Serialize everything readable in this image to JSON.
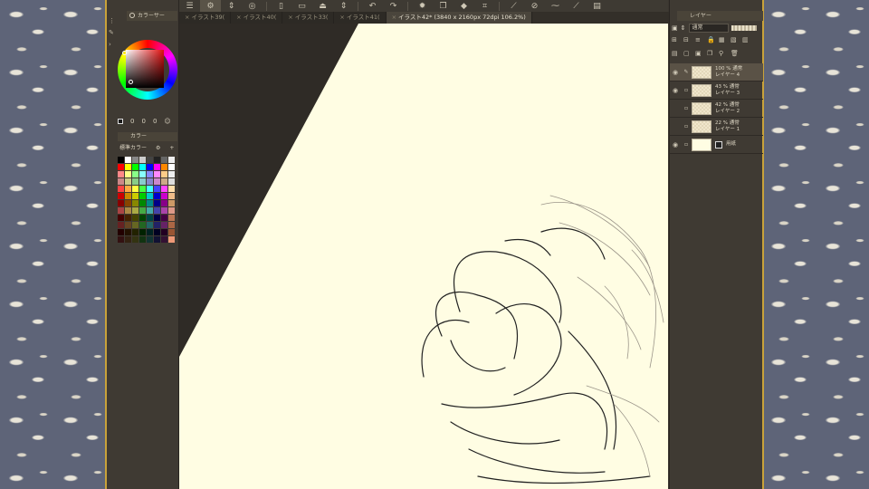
{
  "left_panel": {
    "color_wheel_title": "カラーサー",
    "color_values": [
      "0",
      "0",
      "0"
    ],
    "sub_panel_title": "カラー",
    "palette_dropdown": "標準カラー"
  },
  "tabs": [
    {
      "label": "イラスト39(",
      "active": false
    },
    {
      "label": "イラスト40(",
      "active": false
    },
    {
      "label": "イラスト33(",
      "active": false
    },
    {
      "label": "イラスト41(",
      "active": false
    },
    {
      "label": "イラスト42* (3840 x 2160px 72dpi 106.2%)",
      "active": true
    }
  ],
  "right_panel": {
    "title": "レイヤー",
    "blend_mode": "通常",
    "layers": [
      {
        "opacity": "100 %  通常",
        "name": "レイヤー 4",
        "selected": true,
        "visible": true
      },
      {
        "opacity": "43 %  通常",
        "name": "レイヤー 3",
        "selected": false,
        "visible": true
      },
      {
        "opacity": "42 %  通常",
        "name": "レイヤー 2",
        "selected": false,
        "visible": false
      },
      {
        "opacity": "22 %  通常",
        "name": "レイヤー 1",
        "selected": false,
        "visible": false
      },
      {
        "opacity": "",
        "name": "用紙",
        "selected": false,
        "visible": true,
        "paper": true
      }
    ]
  },
  "colors": {
    "canvas": "#fffde3",
    "app_bg": "#3b3630",
    "panel_bg": "#3f3a33",
    "accent_gold": "#c9a23a"
  },
  "icons": {
    "menu": "hamburger-icon",
    "undo": "undo-icon",
    "redo": "redo-icon"
  }
}
